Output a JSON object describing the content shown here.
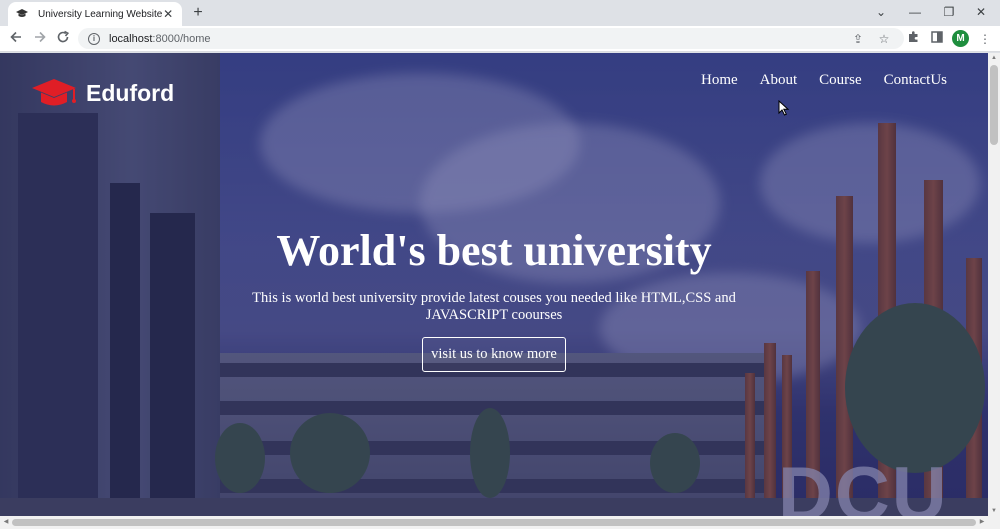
{
  "browser": {
    "tab_title": "University Learning Website",
    "url_host": "localhost",
    "url_rest": ":8000/home",
    "profile_initial": "M"
  },
  "site": {
    "brand": "Eduford",
    "nav": [
      "Home",
      "About",
      "Course",
      "ContactUs"
    ],
    "hero_title": "World's best university",
    "hero_subtitle": "This is world best university provide latest couses you needed like HTML,CSS and JAVASCRIPT coourses",
    "hero_button": "visit us to know more",
    "sign_text": "DCU",
    "overlay_color": "#24246e",
    "logo_color": "#e01e26"
  },
  "icons": {
    "tab_favicon": "graduation-cap-icon",
    "back": "back-arrow-icon",
    "forward": "forward-arrow-icon",
    "reload": "reload-icon",
    "info": "info-icon",
    "share": "share-icon",
    "bookmark": "star-icon",
    "extensions": "puzzle-icon",
    "side_panel": "side-panel-icon",
    "menu": "kebab-menu-icon"
  }
}
